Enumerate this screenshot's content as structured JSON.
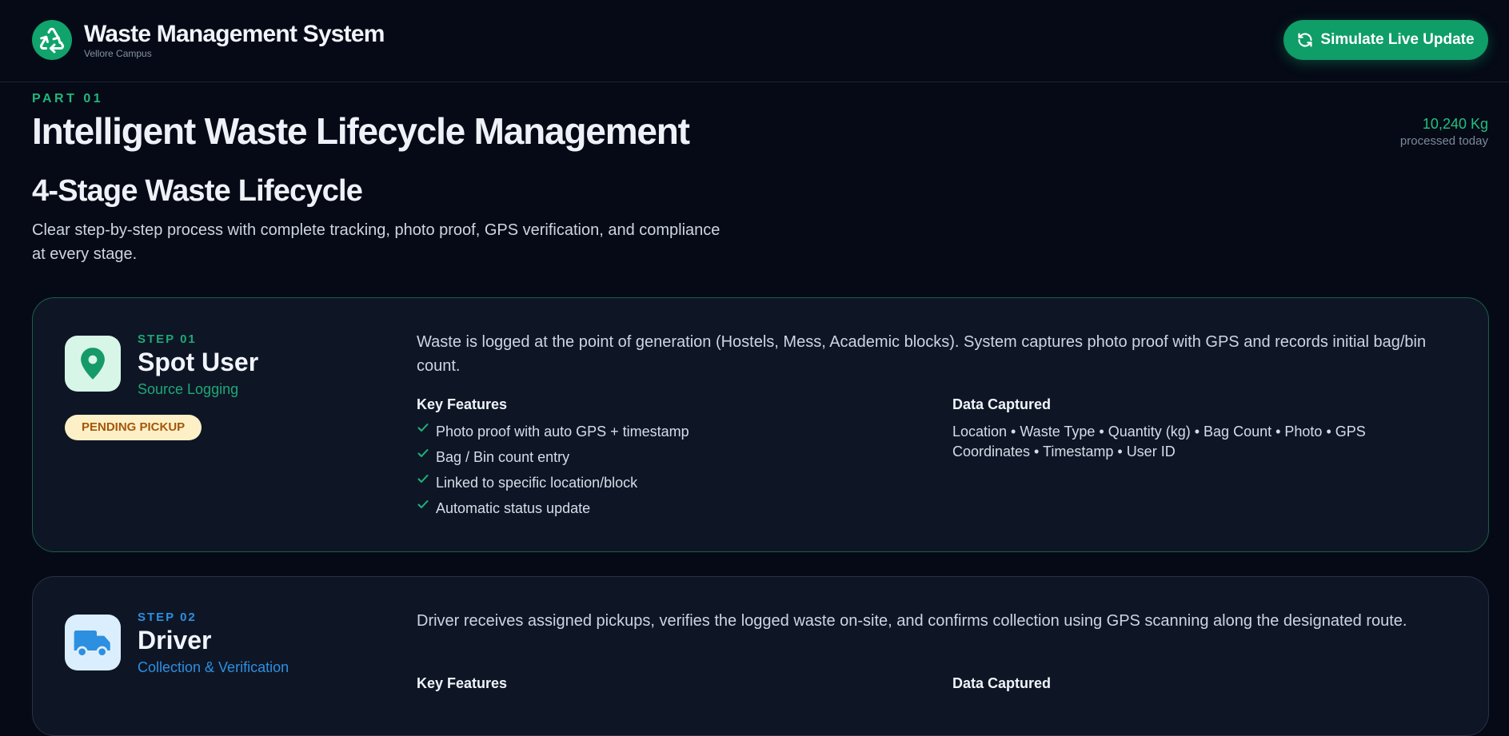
{
  "header": {
    "title": "Waste Management System",
    "subtitle": "Vellore Campus",
    "live_button_label": "Simulate Live Update",
    "logo_icon": "recycle-icon",
    "button_icon": "refresh-icon"
  },
  "hero": {
    "part_label": "PART 01",
    "title": "Intelligent Waste Lifecycle Management",
    "stat_value": "10,240 Kg",
    "stat_label": "processed today"
  },
  "section": {
    "title": "4-Stage Waste Lifecycle",
    "description": "Clear step-by-step process with complete tracking, photo proof, GPS verification, and compliance at every stage."
  },
  "steps": [
    {
      "number": "STEP 01",
      "name": "Spot User",
      "subtitle": "Source Logging",
      "status": "PENDING PICKUP",
      "icon": "map-pin-icon",
      "accent_color": "#1fa874",
      "description": "Waste is logged at the point of generation (Hostels, Mess, Academic blocks). System captures photo proof with GPS and records initial bag/bin count.",
      "features_title": "Key Features",
      "features": [
        "Photo proof with auto GPS + timestamp",
        "Bag / Bin count entry",
        "Linked to specific location/block",
        "Automatic status update"
      ],
      "data_title": "Data Captured",
      "data_captured": "Location • Waste Type • Quantity (kg) • Bag Count • Photo • GPS Coordinates • Timestamp • User ID"
    },
    {
      "number": "STEP 02",
      "name": "Driver",
      "subtitle": "Collection & Verification",
      "icon": "truck-icon",
      "accent_color": "#2d8fe0",
      "description": "Driver receives assigned pickups, verifies the logged waste on-site, and confirms collection using GPS scanning along the designated route.",
      "features_title": "Key Features",
      "data_title": "Data Captured"
    }
  ]
}
